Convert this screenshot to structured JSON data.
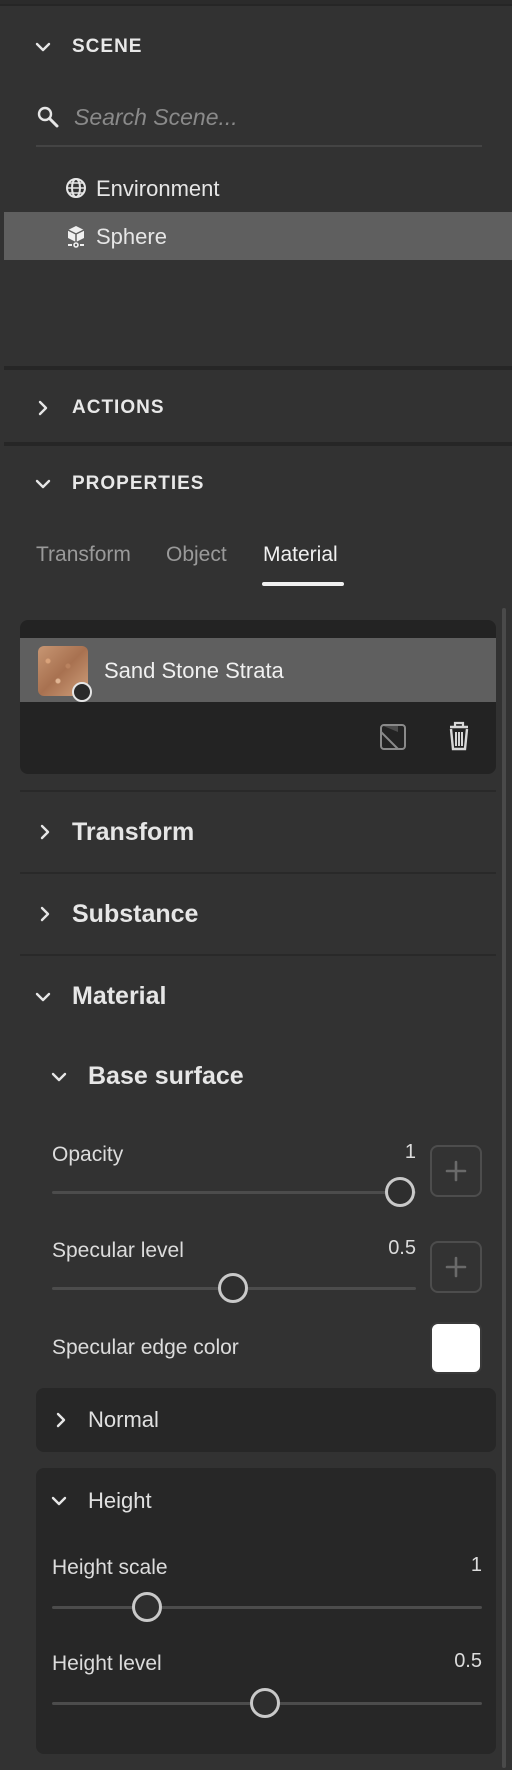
{
  "scene": {
    "title": "SCENE",
    "search_placeholder": "Search Scene...",
    "items": [
      {
        "label": "Environment",
        "icon": "globe-icon"
      },
      {
        "label": "Sphere",
        "icon": "object-icon",
        "selected": true
      }
    ]
  },
  "actions": {
    "title": "ACTIONS"
  },
  "properties": {
    "title": "PROPERTIES",
    "tabs": [
      {
        "label": "Transform"
      },
      {
        "label": "Object"
      },
      {
        "label": "Material",
        "active": true
      }
    ]
  },
  "material_card": {
    "name": "Sand Stone Strata",
    "actions": [
      "replace-material-icon",
      "trash-icon"
    ]
  },
  "groups": {
    "transform": "Transform",
    "substance": "Substance",
    "material": "Material"
  },
  "base_surface": {
    "title": "Base surface",
    "opacity": {
      "label": "Opacity",
      "value": "1",
      "fraction": 1.0
    },
    "specular_level": {
      "label": "Specular level",
      "value": "0.5",
      "fraction": 0.5
    },
    "specular_edge_color": {
      "label": "Specular edge color",
      "color": "#ffffff"
    }
  },
  "normal": {
    "title": "Normal"
  },
  "height": {
    "title": "Height",
    "height_scale": {
      "label": "Height scale",
      "value": "1",
      "fraction": 0.23
    },
    "height_level": {
      "label": "Height level",
      "value": "0.5",
      "fraction": 0.5
    }
  },
  "colors": {
    "panel_bg": "#323232",
    "selected_row": "#5f5f5f",
    "card_bg": "#232323",
    "text": "#e6e6e6"
  }
}
